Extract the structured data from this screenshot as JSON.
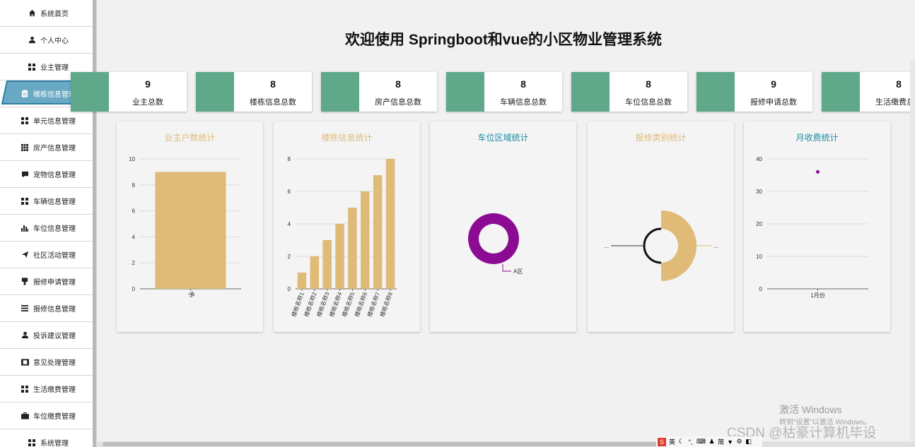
{
  "sidebar": {
    "items": [
      {
        "label": "系统首页",
        "icon": "home-icon"
      },
      {
        "label": "个人中心",
        "icon": "user-icon"
      },
      {
        "label": "业主管理",
        "icon": "grid-icon"
      },
      {
        "label": "楼栋信息管理",
        "icon": "clipboard-icon",
        "active": true
      },
      {
        "label": "单元信息管理",
        "icon": "grid-icon"
      },
      {
        "label": "房产信息管理",
        "icon": "grid9-icon"
      },
      {
        "label": "宠物信息管理",
        "icon": "comment-icon"
      },
      {
        "label": "车辆信息管理",
        "icon": "grid-icon"
      },
      {
        "label": "车位信息管理",
        "icon": "bar-chart-icon"
      },
      {
        "label": "社区活动管理",
        "icon": "send-icon"
      },
      {
        "label": "报修申请管理",
        "icon": "pin-icon"
      },
      {
        "label": "报修信息管理",
        "icon": "list-icon"
      },
      {
        "label": "投诉建议管理",
        "icon": "user-icon"
      },
      {
        "label": "意见处理管理",
        "icon": "film-icon"
      },
      {
        "label": "生活缴费管理",
        "icon": "grid-icon"
      },
      {
        "label": "车位缴费管理",
        "icon": "briefcase-icon"
      },
      {
        "label": "系统管理",
        "icon": "grid-icon"
      }
    ]
  },
  "header": {
    "title": "欢迎使用 Springboot和vue的小区物业管理系统"
  },
  "stats": [
    {
      "value": "9",
      "label": "业主总数"
    },
    {
      "value": "8",
      "label": "楼栋信息总数"
    },
    {
      "value": "8",
      "label": "房产信息总数"
    },
    {
      "value": "8",
      "label": "车辆信息总数"
    },
    {
      "value": "8",
      "label": "车位信息总数"
    },
    {
      "value": "9",
      "label": "报修申请总数"
    },
    {
      "value": "8",
      "label": "生活缴费总数"
    }
  ],
  "colors": {
    "stat_bar": "#5fa88a",
    "gold": "#dfbb77",
    "purple": "#8b0b93",
    "teal_title": "#1c8ea3"
  },
  "chart_data": [
    {
      "type": "bar",
      "title": "业主户数统计",
      "categories": [
        "男"
      ],
      "values": [
        9
      ],
      "ylim": [
        0,
        10
      ],
      "yticks": [
        "0",
        "2",
        "4",
        "6",
        "8",
        "10"
      ],
      "xlabel": "",
      "ylabel": "",
      "grid": true
    },
    {
      "type": "bar",
      "title": "楼栋信息统计",
      "categories": [
        "楼栋名称1",
        "楼栋名称2",
        "楼栋名称3",
        "楼栋名称4",
        "楼栋名称5",
        "楼栋名称6",
        "楼栋名称7",
        "楼栋名称8"
      ],
      "values": [
        1,
        2,
        3,
        4,
        5,
        6,
        7,
        8
      ],
      "ylim": [
        0,
        8
      ],
      "yticks": [
        "0",
        "2",
        "4",
        "6",
        "8"
      ],
      "xlabel": "",
      "ylabel": "",
      "grid": true
    },
    {
      "type": "pie",
      "title": "车位区域统计",
      "donut": true,
      "slices": [
        {
          "name": "A区",
          "value": 8
        }
      ]
    },
    {
      "type": "pie",
      "title": "报修类别统计",
      "donut": true,
      "slices": [
        {
          "name": "...",
          "value": 1
        },
        {
          "name": "...",
          "value": 1
        }
      ]
    },
    {
      "type": "scatter",
      "title": "月收费统计",
      "categories": [
        "1月份"
      ],
      "values": [
        36
      ],
      "ylim": [
        0,
        40
      ],
      "yticks": [
        "0",
        "10",
        "20",
        "30",
        "40"
      ],
      "xlabel": "",
      "ylabel": "",
      "grid": true
    }
  ],
  "watermark": {
    "line1": "激活 Windows",
    "line2": "转到“设置”以激活 Windows。",
    "csdn": "CSDN @枯豪计算机毕设"
  },
  "tray": {
    "lang": "英",
    "simp": "简"
  }
}
